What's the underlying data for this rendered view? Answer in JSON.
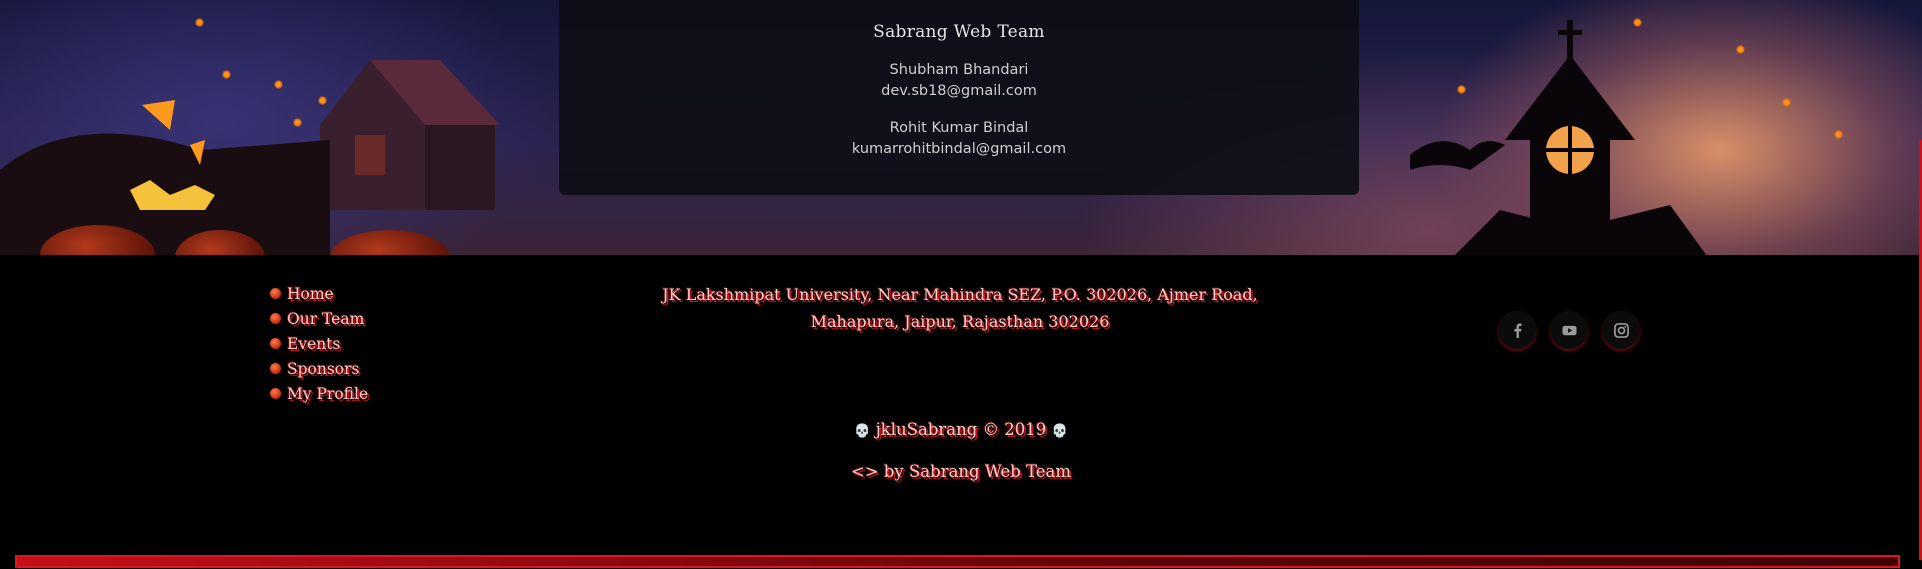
{
  "credits": {
    "title": "Sabrang Web Team",
    "members": [
      {
        "name": "Shubham Bhandari",
        "email": "dev.sb18@gmail.com"
      },
      {
        "name": "Rohit Kumar Bindal",
        "email": "kumarrohitbindal@gmail.com"
      }
    ]
  },
  "nav": {
    "items": [
      {
        "label": "Home"
      },
      {
        "label": "Our Team"
      },
      {
        "label": "Events"
      },
      {
        "label": "Sponsors"
      },
      {
        "label": "My Profile"
      }
    ]
  },
  "address": {
    "line1": "JK Lakshmipat University, Near Mahindra SEZ, P.O. 302026, Ajmer Road,",
    "line2": "Mahapura, Jaipur, Rajasthan 302026"
  },
  "social": [
    {
      "icon": "facebook-icon"
    },
    {
      "icon": "youtube-icon"
    },
    {
      "icon": "instagram-icon"
    }
  ],
  "footer": {
    "skull": "💀",
    "copyright": "jkluSabrang © 2019",
    "code_symbol": "<>",
    "credit": "by Sabrang Web Team"
  },
  "colors": {
    "accent_red": "#c80f1a",
    "footer_bg": "#000000",
    "text_light": "#f2d2c8"
  }
}
